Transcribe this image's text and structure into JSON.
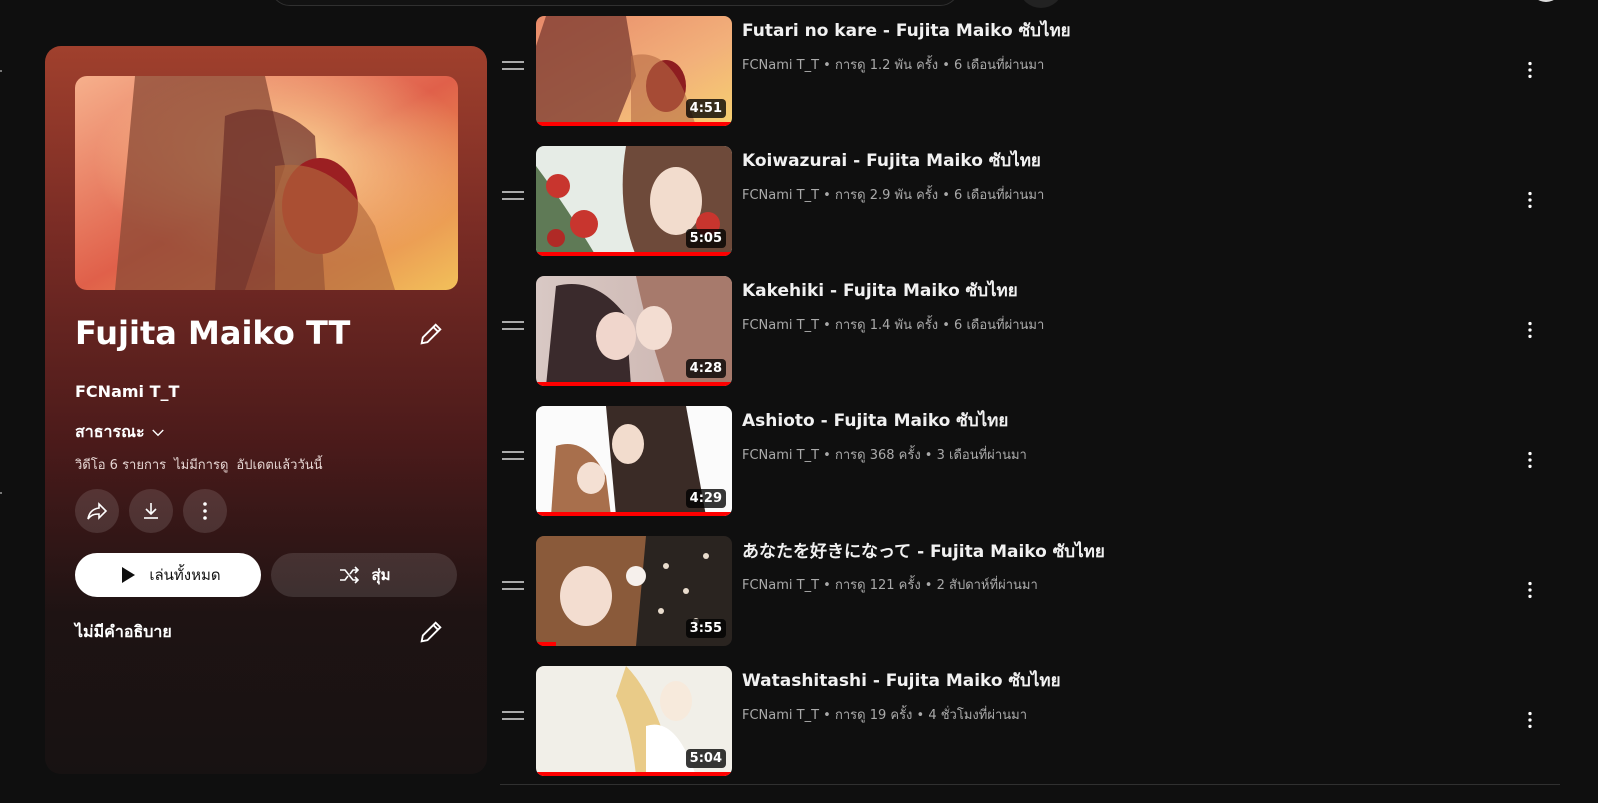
{
  "playlist": {
    "title": "Fujita Maiko TT",
    "owner": "FCNami T_T",
    "privacy": "สาธารณะ",
    "video_count": "วิดีโอ 6 รายการ",
    "views": "ไม่มีการดู",
    "updated": "อัปเดตแล้ววันนี้",
    "play_all_label": "เล่นทั้งหมด",
    "shuffle_label": "สุ่ม",
    "description": "ไม่มีคำอธิบาย"
  },
  "videos": [
    {
      "title": "Futari no kare - Fujita Maiko ซับไทย",
      "meta": "FCNami T_T • การดู 1.2 พัน ครั้ง • 6 เดือนที่ผ่านมา",
      "duration": "4:51",
      "progress": 1.0
    },
    {
      "title": "Koiwazurai - Fujita Maiko ซับไทย",
      "meta": "FCNami T_T • การดู 2.9 พัน ครั้ง • 6 เดือนที่ผ่านมา",
      "duration": "5:05",
      "progress": 1.0
    },
    {
      "title": "Kakehiki - Fujita Maiko ซับไทย",
      "meta": "FCNami T_T • การดู 1.4 พัน ครั้ง • 6 เดือนที่ผ่านมา",
      "duration": "4:28",
      "progress": 1.0
    },
    {
      "title": "Ashioto - Fujita Maiko ซับไทย",
      "meta": "FCNami T_T • การดู 368 ครั้ง • 3 เดือนที่ผ่านมา",
      "duration": "4:29",
      "progress": 1.0
    },
    {
      "title": "あなたを好きになって - Fujita Maiko ซับไทย",
      "meta": "FCNami T_T • การดู 121 ครั้ง • 2 สัปดาห์ที่ผ่านมา",
      "duration": "3:55",
      "progress": 0.1
    },
    {
      "title": "Watashitashi - Fujita Maiko ซับไทย",
      "meta": "FCNami T_T • การดู 19 ครั้ง • 4 ชั่วโมงที่ผ่านมา",
      "duration": "5:04",
      "progress": 1.0
    }
  ],
  "colors": {
    "accent": "#ff0000",
    "background": "#0f0f0f",
    "card_top": "#a0402d"
  }
}
